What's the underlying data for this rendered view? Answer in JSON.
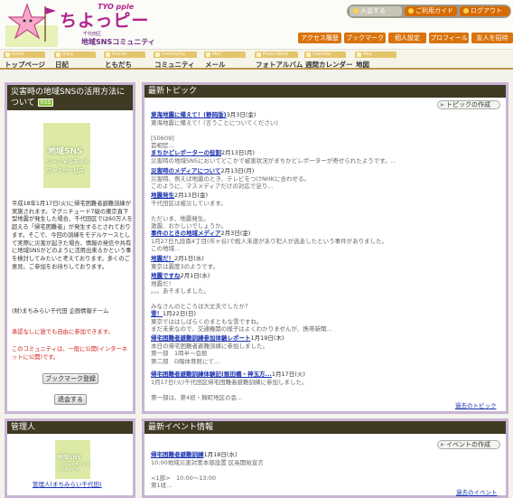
{
  "header": {
    "logo_title": "ちよっピー",
    "logo_tyo": "TYO pple",
    "logo_sub1": "千代田区",
    "logo_sub2": "地域SNSコミュニティ",
    "login_links": [
      "入会する",
      "ご利用ガイド",
      "ログアウト"
    ],
    "sub_menu": [
      "アクセス履歴",
      "ブックマーク",
      "個人設定",
      "プロフィール",
      "友人を招待"
    ]
  },
  "nav": [
    {
      "tab": "Home",
      "label": "トップページ"
    },
    {
      "tab": "Diary",
      "label": "日記"
    },
    {
      "tab": "Friends",
      "label": "ともだち"
    },
    {
      "tab": "Community",
      "label": "コミュニティ"
    },
    {
      "tab": "Mail",
      "label": "メール"
    },
    {
      "tab": "Photo album",
      "label": "フォトアルバム"
    },
    {
      "tab": "Calendar",
      "label": "週間カレンダー"
    },
    {
      "tab": "Map",
      "label": "地図"
    }
  ],
  "community": {
    "title": "災害時の地域SNSの活用方法について",
    "rss": "RSS",
    "image_text": [
      "地域SNS",
      "ソーシャルネット",
      "ワークサービス"
    ],
    "description": "平成18年1月17日(火)に帰宅困難者避難訓練が実施されます。マグニチュード7級の東京直下型地震が発生した場合、千代田区では60万人を超える「帰宅困難者」が発生するとされております。そこで、今回の訓練をモデルケースとして実際に災害が起きた場合、情報の発信や共有に地域SNSがどのように活用出来るかという事を検討してみたいと考えております。多くのご意見、ご参加をお待ちしております。",
    "organizer": "(財)まちみらい千代田 企画情報チーム",
    "note1": "承認なしに誰でも自由に参加できます。",
    "note2": "このコミュニティは、一般に公開(インターネットに公開)です。",
    "bookmark_btn": "ブックマーク登録",
    "leave_btn": "退会する"
  },
  "admin": {
    "title": "管理人",
    "image_text": [
      "地域SNS",
      "ソーシャルネットワークサービス"
    ],
    "link": "管理人(まちみらい千代田)"
  },
  "topics": {
    "title": "最新トピック",
    "create_btn": "トピックの作成",
    "more": "過去のトピック",
    "items": [
      {
        "title": "東海地震に備えて！(静岡版)",
        "date": "3月3日(金)",
        "body": "東海地震に備えて！(言うことについてください)\n\n[50609]\n首相官..."
      },
      {
        "title": "まちかどレポーターの役割",
        "date": "2月13日(月)",
        "body": "災害時の地域SNSにおいてどこかで被害状況がまちかどレポーターが寄せられたようです。..."
      },
      {
        "title": "災害時のメディアについて",
        "date": "2月13日(月)",
        "body": "災害時、例えば地震のとき、テレビをつけNHKに合わせる。\nこのように、マスメディアだけの対応で足り..."
      },
      {
        "title": "地震発生",
        "date": "2月13日(金)",
        "body": "千代田区は被災しています。\n\nただいま、地震発生。\n激震、おかしいでしょうか。"
      },
      {
        "title": "事件のときの地域メディア",
        "date": "2月3日(金)",
        "body": "1月27日九段南4丁目(市ヶ谷)で殺人未遂があり犯人が逃走したという事件がありました。\nこの地域..."
      },
      {
        "title": "地震だ！",
        "date": "2月1日(水)",
        "body": "東京は震度3のようです。"
      },
      {
        "title": "地震ですね",
        "date": "2月1日(水)",
        "body": "地震だ！\n。。。あそましました。\n\nみなさんのところは大丈夫でしたか？"
      },
      {
        "title": "雪！",
        "date": "1月22日(日)",
        "body": "東京でははしばらくのまともな雪ですね。\nまだ未来なので、交通機関の様子はよくわかりませんが、携帯新聞..."
      },
      {
        "title": "帰宅困難者避難訓練参加体験レポート",
        "date": "1月19日(木)",
        "body": "本日の帰宅困難者避難訓練に参加しました。\n第一部　1時半～会館\n第二部　D階体育館にて..."
      },
      {
        "title": "帰宅困難者避難訓練体験記(飯田橋・神玉方...",
        "date": "1月17日(火)",
        "body": "1月17日(火)千代田区帰宅困難者避難訓練に参加しました。\n\n第一部は、第4班・麹町地区の会..."
      }
    ]
  },
  "events": {
    "title": "最新イベント情報",
    "create_btn": "イベントの作成",
    "more": "過去のイベント",
    "items": [
      {
        "title": "帰宅困難者避難訓練",
        "date": "1月18日(水)",
        "body": "10:00地域災害対策本部設置 区長開始宣言\n\n<1部>　10:00～13:00\n第1班..."
      }
    ]
  },
  "colors": {
    "accent_orange": "#d9730c",
    "panel_head": "#3f3a23",
    "link_blue": "#1a32b0",
    "panel_border": "#c9b4d4",
    "brand_pink": "#b0248f"
  }
}
